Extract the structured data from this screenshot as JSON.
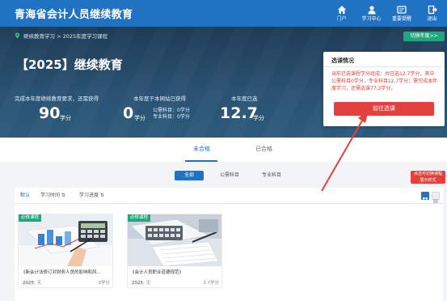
{
  "header": {
    "logo": "青海省会计人员继续教育",
    "nav": [
      {
        "label": "门户",
        "icon": "home-icon"
      },
      {
        "label": "学习中心",
        "icon": "user-icon"
      },
      {
        "label": "重要提醒",
        "icon": "notice-icon"
      },
      {
        "label": "退出",
        "icon": "logout-icon"
      }
    ]
  },
  "breadcrumb": "继续教育学习 > 2025年度学习课程",
  "switch_year": "切换年度>>",
  "hero": {
    "title": "【2025】继续教育",
    "required_label": "完成本年度继续教育要求，还需获得",
    "required_value": "90",
    "required_unit": "学分",
    "obtained_label": "本年度于本网站已获得",
    "obtained_value": "0",
    "obtained_unit": "学分",
    "public_subject": "公需科目：0学分",
    "professional_subject": "专业科目：0学分",
    "selected_label": "本年度已选",
    "selected_value": "12.7",
    "selected_unit": "学分"
  },
  "popup": {
    "title": "选课情况",
    "text": "当前已选课程学分组成：共已选12.7学分，其中公需科目0学分，专业科目12.7学分；需完成本年度学习，还需选课77.3学分。",
    "button": "前往选课"
  },
  "status_tabs": [
    {
      "label": "未合格",
      "active": true
    },
    {
      "label": "已合格",
      "active": false
    }
  ],
  "category_pills": [
    {
      "label": "全部",
      "active": true
    },
    {
      "label": "公需科目",
      "active": false
    },
    {
      "label": "专业科目",
      "active": false
    }
  ],
  "sort_tabs": [
    {
      "label": "默认",
      "active": true
    },
    {
      "label": "学习时间 ⇅",
      "active": false
    },
    {
      "label": "学习进度 ⇅",
      "active": false
    }
  ],
  "annotation": "点击可切换课程\n展示样式",
  "courses": [
    {
      "badge": "必修课程",
      "title": "《新会计法修订对财务人员的影响和风...",
      "year": "2025",
      "type": "无",
      "credit": "9学分"
    },
    {
      "badge": "必修课程",
      "title": "《会计人员职业道德规范》",
      "year": "2025",
      "type": "无",
      "credit": "3.7学分"
    }
  ],
  "colors": {
    "primary": "#1f73c2",
    "accent_green": "#1ea97c",
    "alert_red": "#e3413e",
    "hero_bg": "#24496a"
  }
}
